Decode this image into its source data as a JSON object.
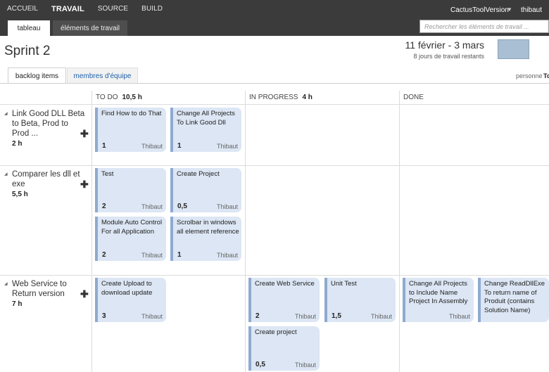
{
  "topnav": {
    "items": [
      "ACCUEIL",
      "TRAVAIL",
      "SOURCE",
      "BUILD"
    ],
    "project": "CactusToolVersion",
    "user": "thibaut"
  },
  "subtabs": {
    "board": "tableau",
    "work_items": "éléments de travail"
  },
  "search": {
    "placeholder": "Rechercher les éléments de travail ..."
  },
  "sprint": {
    "title": "Sprint 2",
    "dates": "11 février - 3 mars",
    "remaining": "8 jours de travail restants"
  },
  "view_tabs": {
    "backlog": "backlog items",
    "team": "membres d'équipe"
  },
  "filter": {
    "label": "personne",
    "value": "To"
  },
  "columns": [
    {
      "name": "TO DO",
      "hours": "10,5 h"
    },
    {
      "name": "IN PROGRESS",
      "hours": "4 h"
    },
    {
      "name": "DONE",
      "hours": ""
    }
  ],
  "rows": [
    {
      "title": "Link Good DLL Beta to Beta, Prod to Prod ...",
      "hours": "2 h",
      "cards": [
        {
          "title": "Find How to do That",
          "estimate": "1",
          "owner": "Thibaut"
        },
        {
          "title": "Change All Projects To Link Good Dll",
          "estimate": "1",
          "owner": "Thibaut"
        }
      ]
    },
    {
      "title": "Comparer les dll et exe",
      "hours": "5,5 h",
      "cards": [
        {
          "title": "Test",
          "estimate": "2",
          "owner": "Thibaut"
        },
        {
          "title": "Create Project",
          "estimate": "0,5",
          "owner": "Thibaut"
        },
        {
          "title": "Module Auto Control For all Application",
          "estimate": "2",
          "owner": "Thibaut"
        },
        {
          "title": "Scrolbar in windows all element reference",
          "estimate": "1",
          "owner": "Thibaut"
        }
      ]
    },
    {
      "title": "Web Service to Return version",
      "hours": "7 h",
      "cards": [
        {
          "title": "Create Upload to download update",
          "estimate": "3",
          "owner": "Thibaut"
        },
        {
          "title": "Create Web Service",
          "estimate": "2",
          "owner": "Thibaut"
        },
        {
          "title": "Unit Test",
          "estimate": "1,5",
          "owner": "Thibaut"
        },
        {
          "title": "Create project",
          "estimate": "0,5",
          "owner": "Thibaut"
        },
        {
          "title": "Change All Projects to Include Name Project In Assembly",
          "estimate": "",
          "owner": "Thibaut"
        },
        {
          "title": "Change ReadDllExe To return name of Produit (contains Solution Name)",
          "estimate": "",
          "owner": ""
        }
      ]
    }
  ],
  "colors": {
    "card_bg": "#dce6f4",
    "card_border": "#8faad0",
    "topbar": "#3b3b3b",
    "link": "#1f5fa8"
  },
  "icons": {
    "expand": "triangle-icon",
    "add": "plus-icon"
  }
}
